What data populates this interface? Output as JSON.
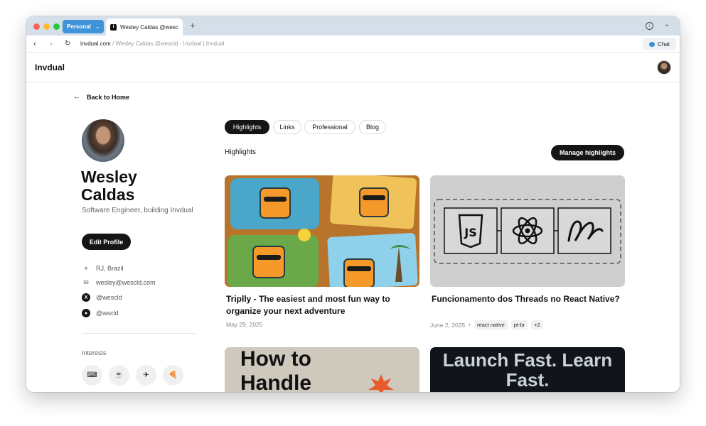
{
  "browser": {
    "profile_label": "Personal",
    "tab_title": "Wesley Caldas @wescld",
    "url_domain": "invdual.com",
    "url_rest": " / Wesley Caldas @wescld - Invdual | Invdual",
    "chat_label": "Chat"
  },
  "site": {
    "logo": "Invdual"
  },
  "profile": {
    "back_label": "Back to Home",
    "name": "Wesley Caldas",
    "tagline": "Software Engineer, building Invdual",
    "edit_label": "Edit Profile",
    "location": "RJ, Brazil",
    "email": "wesley@wescld.com",
    "x_handle": "@wescld",
    "github_handle": "@wscld",
    "interests_label": "Interests",
    "interests": [
      "⌨",
      "☕",
      "✈",
      "🍕"
    ]
  },
  "tabs": [
    "Highlights",
    "Links",
    "Professional",
    "Blog"
  ],
  "section": {
    "title": "Highlights",
    "manage_label": "Manage highlights"
  },
  "cards": [
    {
      "title": "Triplly - The easiest and most fun way to organize your next adventure",
      "date": "May 29, 2025"
    },
    {
      "title": "Funcionamento dos Threads no React Native?",
      "date": "June 2, 2025",
      "tags": [
        "react native",
        "pt-br",
        "+2"
      ]
    },
    {
      "image_text": "How to Handle"
    },
    {
      "image_text": "Launch Fast. Learn Fast."
    }
  ],
  "colors": {
    "accent_blue": "#3f93d8",
    "dark": "#151515"
  }
}
